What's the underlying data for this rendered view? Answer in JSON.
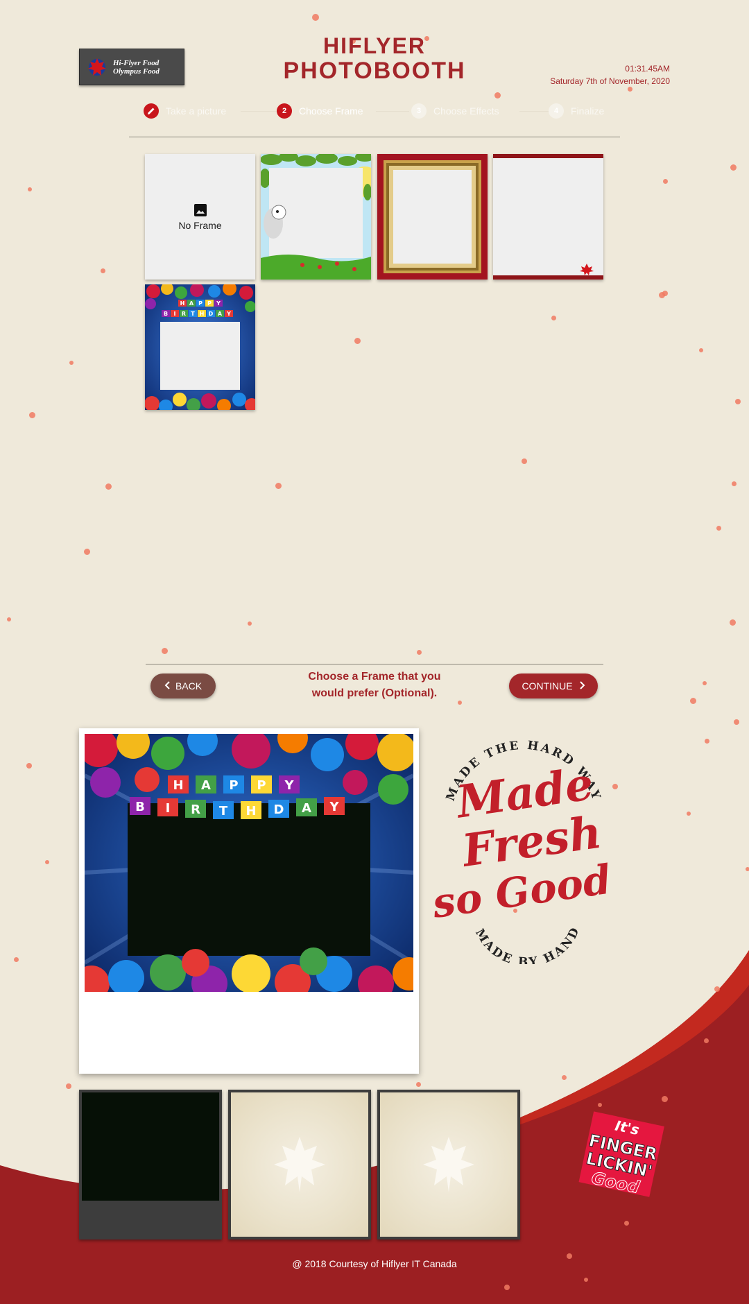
{
  "brand": {
    "logo_line1": "Hi-Flyer Food",
    "logo_line2": "Olympus Food",
    "title_line1": "HIFLYER",
    "title_line2": "PHOTOBOOTH"
  },
  "clock": {
    "time": "01:31.45AM",
    "date": "Saturday 7th of November, 2020"
  },
  "steps": [
    {
      "number": "",
      "label": "Take a picture",
      "icon": "pencil-icon",
      "state": "done"
    },
    {
      "number": "2",
      "label": "Choose Frame",
      "state": "active"
    },
    {
      "number": "3",
      "label": "Choose Effects",
      "state": "inactive"
    },
    {
      "number": "4",
      "label": "Finalize",
      "state": "inactive"
    }
  ],
  "frames": {
    "no_frame_label": "No Frame",
    "items": [
      "No Frame",
      "Cartoon meadow frame",
      "Gold and red frame",
      "Hi-Flyer branded frame",
      "Happy Birthday frame"
    ]
  },
  "nav": {
    "back_label": "BACK",
    "continue_label": "CONTINUE",
    "hint_line1": "Choose a Frame that you",
    "hint_line2": "would prefer (Optional)."
  },
  "birthday_banner": {
    "line1": [
      "H",
      "A",
      "P",
      "P",
      "Y"
    ],
    "line2": [
      "B",
      "I",
      "R",
      "T",
      "H",
      "D",
      "A",
      "Y"
    ]
  },
  "stamp": {
    "top_arc": "MADE THE HARD WAY",
    "script1": "Made",
    "script2": "Fresh",
    "script3": "so Good",
    "bottom_arc": "MADE BY HAND"
  },
  "badge": {
    "line1": "It's",
    "line2": "FINGER",
    "line3": "LICKIN'",
    "line4": "Good"
  },
  "footer": {
    "text": "@ 2018 Courtesy of Hiflyer IT Canada"
  },
  "colors": {
    "brand_red": "#a3262a",
    "accent_red": "#c8151b",
    "background": "#efe9da"
  }
}
